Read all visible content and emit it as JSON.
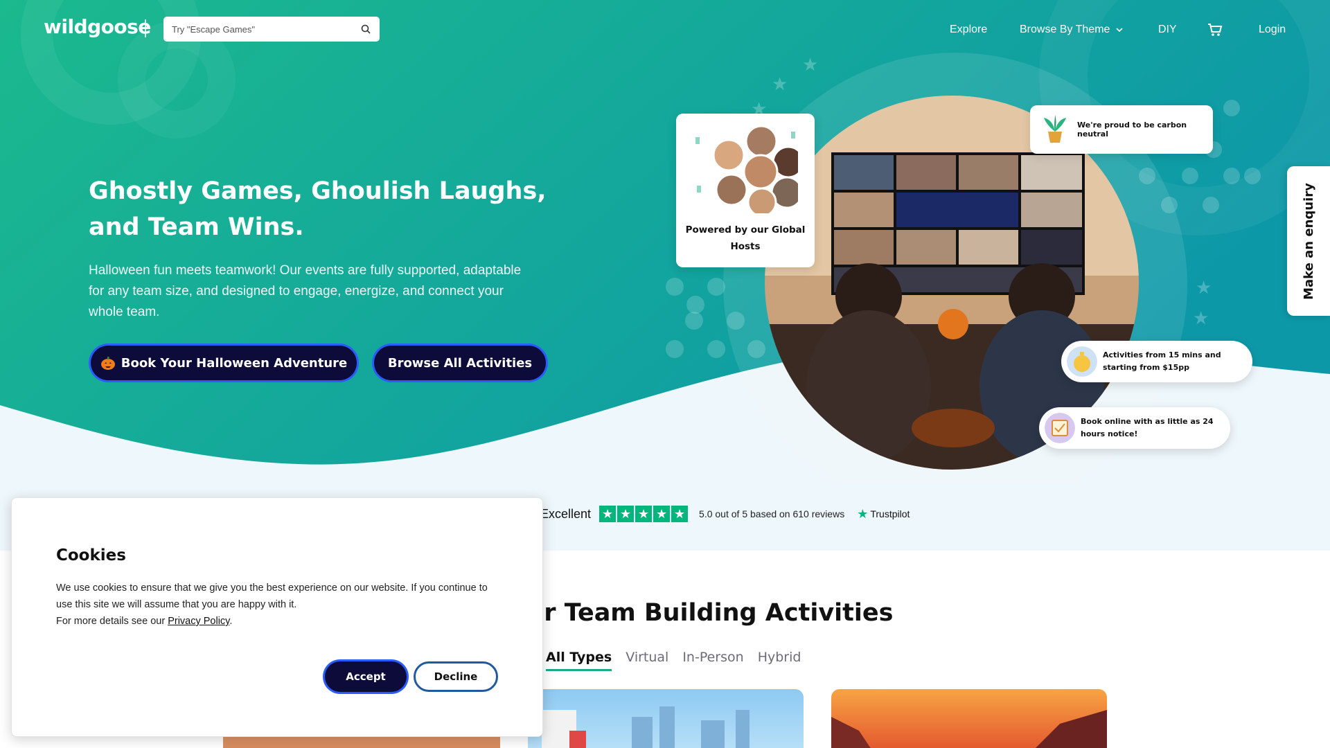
{
  "header": {
    "logo": "wildgoose",
    "search_placeholder": "Try \"Escape Games\"",
    "nav": {
      "explore": "Explore",
      "browse_by_theme": "Browse By Theme",
      "diy": "DIY",
      "login": "Login"
    }
  },
  "hero": {
    "title": "Ghostly Games, Ghoulish Laughs, and Team Wins.",
    "subtitle": "Halloween fun meets teamwork! Our events are fully supported, adaptable for any team size, and designed to engage, energize, and connect your whole team.",
    "primary_button": "Book Your Halloween Adventure",
    "secondary_button": "Browse All Activities",
    "hosts_card": "Powered by our Global Hosts",
    "carbon_card": "We're proud to be carbon neutral",
    "price_pill": "Activities from 15 mins and starting from $15pp",
    "booking_pill": "Book online with as little as 24 hours notice!",
    "enquiry_tab": "Make an enquiry"
  },
  "trustpilot": {
    "label": "Excellent",
    "rating_text": "5.0 out of 5 based on 610 reviews",
    "brand": "Trustpilot",
    "stars": 5
  },
  "activities": {
    "title": "Popular Team Building Activities",
    "tabs": [
      "All Types",
      "Virtual",
      "In-Person",
      "Hybrid"
    ],
    "active_tab": "All Types"
  },
  "cookie": {
    "title": "Cookies",
    "text": "We use cookies to ensure that we give you the best experience on our website. If you continue to use this site we will assume that you are happy with it.",
    "more_prefix": "For more details see our ",
    "more_link": "Privacy Policy",
    "more_suffix": ".",
    "accept": "Accept",
    "decline": "Decline"
  },
  "colors": {
    "hero_gradient_start": "#1bb98e",
    "hero_gradient_end": "#0d98a8",
    "button_dark": "#0d0b3a",
    "trustpilot_green": "#00b67a"
  }
}
